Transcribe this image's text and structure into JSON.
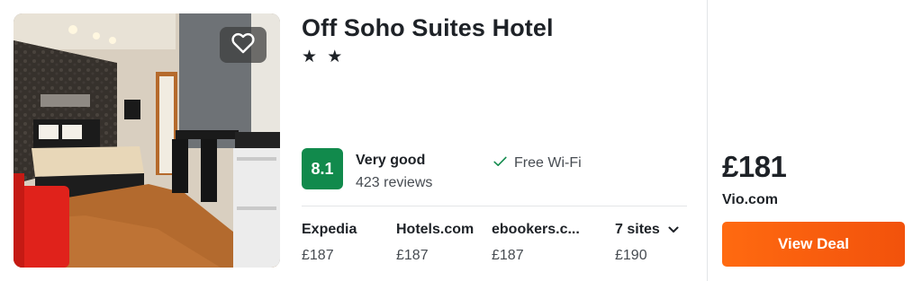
{
  "hotel": {
    "name": "Off Soho Suites Hotel",
    "stars": "★ ★",
    "score": "8.1",
    "rating_label": "Very good",
    "reviews": "423 reviews",
    "amenity": "Free Wi-Fi"
  },
  "providers": [
    {
      "name": "Expedia",
      "price": "£187"
    },
    {
      "name": "Hotels.com",
      "price": "£187"
    },
    {
      "name": "ebookers.c...",
      "price": "£187"
    }
  ],
  "more_sites": {
    "label": "7 sites",
    "price": "£190"
  },
  "deal": {
    "price": "£181",
    "site": "Vio.com",
    "button_label": "View Deal"
  },
  "colors": {
    "score_badge": "#118a4c",
    "deal_button": "#ff6a10",
    "text": "#1e2227"
  },
  "icons": {
    "favorite": "heart-outline-icon",
    "amenity": "check-icon",
    "expand": "chevron-down-icon"
  }
}
